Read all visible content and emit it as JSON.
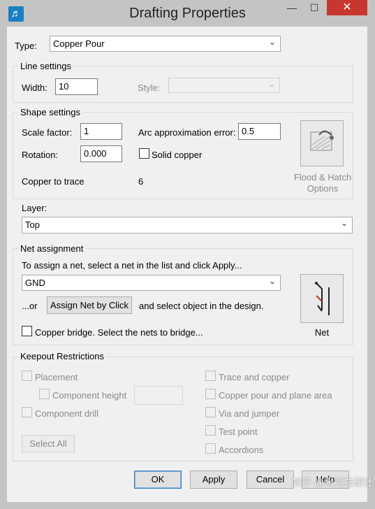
{
  "window": {
    "title": "Drafting Properties",
    "minimize": "—",
    "maximize": "☐",
    "close": "✕",
    "app_icon": "♬"
  },
  "type": {
    "label": "Type:",
    "value": "Copper Pour"
  },
  "line_settings": {
    "title": "Line settings",
    "width_label": "Width:",
    "width_value": "10",
    "style_label": "Style:",
    "style_value": ""
  },
  "shape_settings": {
    "title": "Shape settings",
    "scale_factor_label": "Scale factor:",
    "scale_factor_value": "1",
    "arc_error_label": "Arc approximation error:",
    "arc_error_value": "0.5",
    "rotation_label": "Rotation:",
    "rotation_value": "0.000",
    "solid_copper_label": "Solid copper",
    "solid_copper_checked": false,
    "copper_to_trace_label": "Copper to trace",
    "copper_to_trace_value": "6",
    "flood_hatch_line1": "Flood & Hatch",
    "flood_hatch_line2": "Options"
  },
  "layer": {
    "label": "Layer:",
    "value": "Top"
  },
  "net_assignment": {
    "title": "Net assignment",
    "instruction": "To assign a net, select a net in the list and click Apply...",
    "net_value": "GND",
    "or_label": "...or",
    "assign_button": "Assign Net by Click",
    "after_label": "and select object in the design.",
    "copper_bridge_label": "Copper bridge. Select the nets to bridge...",
    "copper_bridge_checked": false,
    "net_button": "Net"
  },
  "keepout": {
    "title": "Keepout Restrictions",
    "left_items": [
      "Placement",
      "Component height",
      "Component drill"
    ],
    "right_items": [
      "Trace and copper",
      "Copper pour and plane area",
      "Via and jumper",
      "Test point",
      "Accordions"
    ],
    "select_all": "Select All"
  },
  "footer": {
    "ok": "OK",
    "apply": "Apply",
    "cancel": "Cancel",
    "help": "Help"
  },
  "watermark": "知乎 @米霓技研社",
  "colors": {
    "close_button": "#c7372f",
    "window_frame": "#c4c4c4",
    "dialog_bg": "#f0f0f0"
  }
}
